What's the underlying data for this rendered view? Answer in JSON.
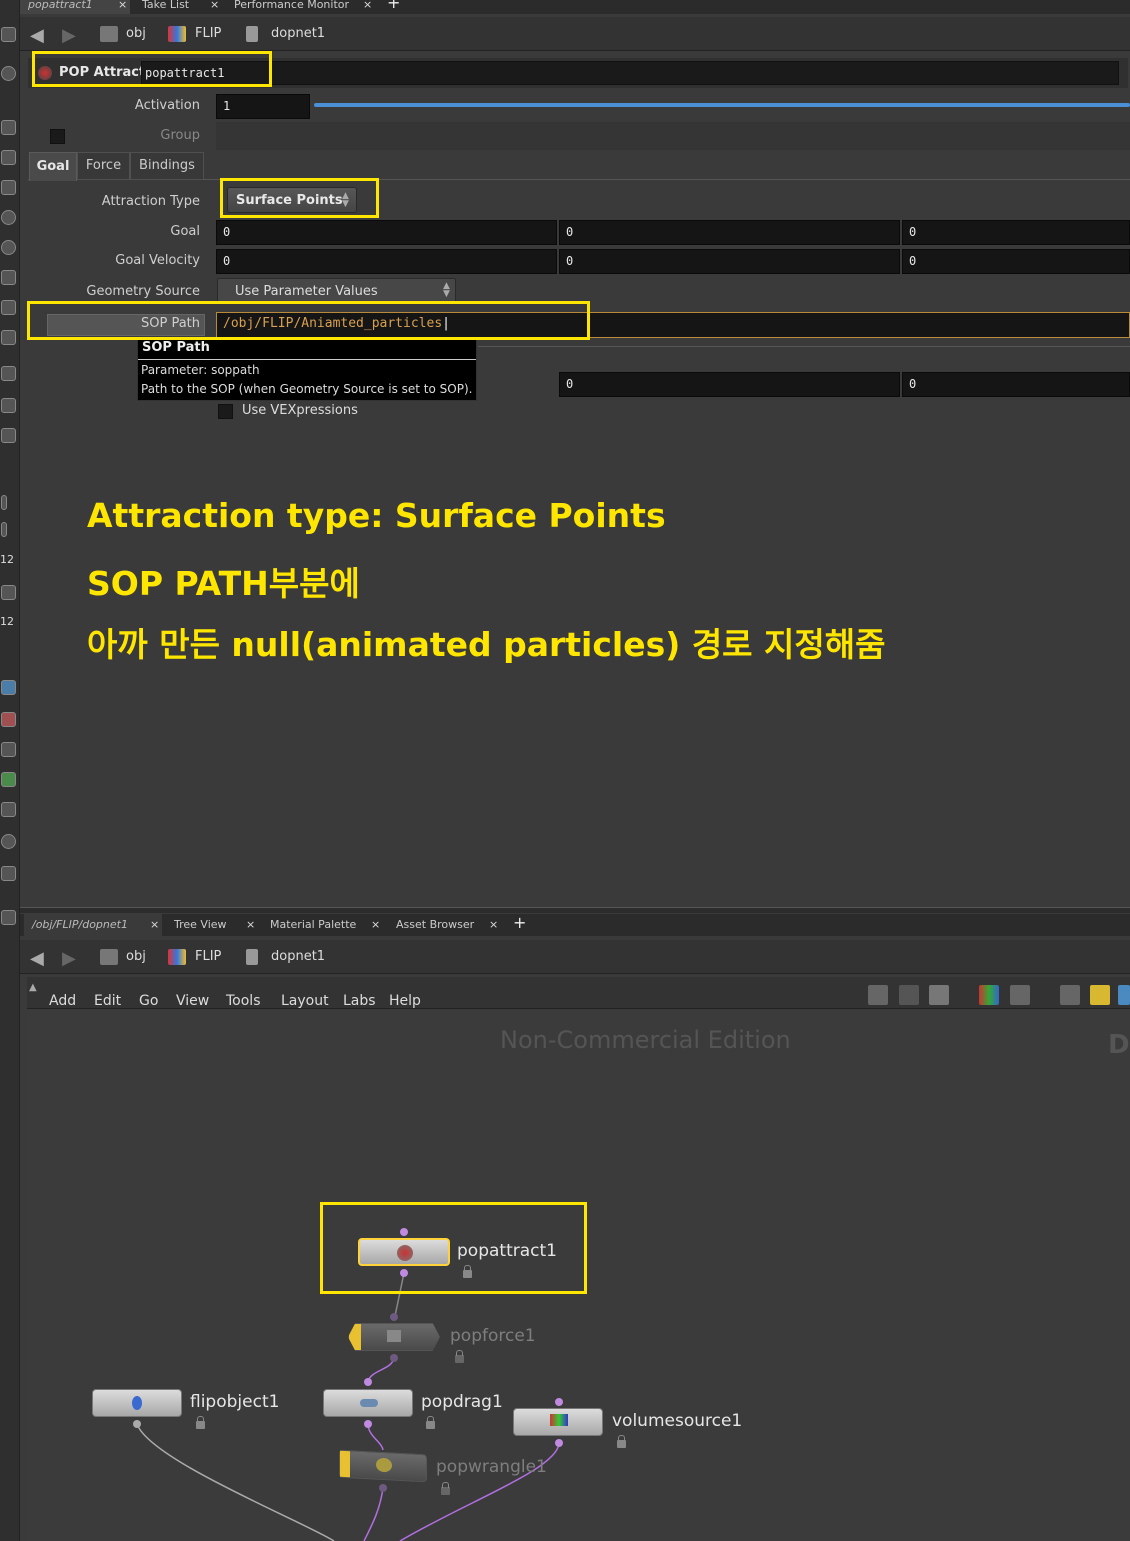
{
  "top_tabs": [
    {
      "label": "popattract1"
    },
    {
      "label": "Take List"
    },
    {
      "label": "Performance Monitor"
    }
  ],
  "breadcrumb": [
    "obj",
    "FLIP",
    "dopnet1"
  ],
  "node_header": {
    "type_label": "POP Attract",
    "name": "popattract1"
  },
  "params": {
    "activation_label": "Activation",
    "activation_value": "1",
    "group_label": "Group",
    "tabs": [
      "Goal",
      "Force",
      "Bindings"
    ],
    "attraction_type_label": "Attraction Type",
    "attraction_type_value": "Surface Points",
    "goal_label": "Goal",
    "goal_values": [
      "0",
      "0",
      "0"
    ],
    "goal_velocity_label": "Goal Velocity",
    "goal_velocity_values": [
      "0",
      "0",
      "0"
    ],
    "geometry_source_label": "Geometry Source",
    "geometry_source_value": "Use Parameter Values",
    "sop_path_label": "SOP Path",
    "sop_path_value": "/obj/FLIP/Aniamted_particles",
    "hidden_row_values": [
      "0",
      "0"
    ],
    "vex_label": "Use VEXpressions"
  },
  "tooltip": {
    "title": "SOP Path",
    "line1": "Parameter: soppath",
    "line2": "Path to the SOP (when Geometry Source is set to SOP)."
  },
  "annotation": {
    "line1": "Attraction type: Surface Points",
    "line2": "SOP PATH부분에",
    "line3": "아까 만든 null(animated particles) 경로 지정해줌"
  },
  "left_toolbar_numbers": [
    "12",
    "12"
  ],
  "bottom_tabs": [
    {
      "label": "/obj/FLIP/dopnet1"
    },
    {
      "label": "Tree View"
    },
    {
      "label": "Material Palette"
    },
    {
      "label": "Asset Browser"
    }
  ],
  "network_menu": [
    "Add",
    "Edit",
    "Go",
    "View",
    "Tools",
    "Layout",
    "Labs",
    "Help"
  ],
  "watermark": "Non-Commercial Edition",
  "watermark_right": "D",
  "nodes": {
    "popattract": "popattract1",
    "popforce": "popforce1",
    "flipobject": "flipobject1",
    "popdrag": "popdrag1",
    "volumesource": "volumesource1",
    "popwrangle": "popwrangle1"
  },
  "colors": {
    "highlight": "#ffe600",
    "wire": "#b070e0",
    "background": "#3a3a3a"
  }
}
